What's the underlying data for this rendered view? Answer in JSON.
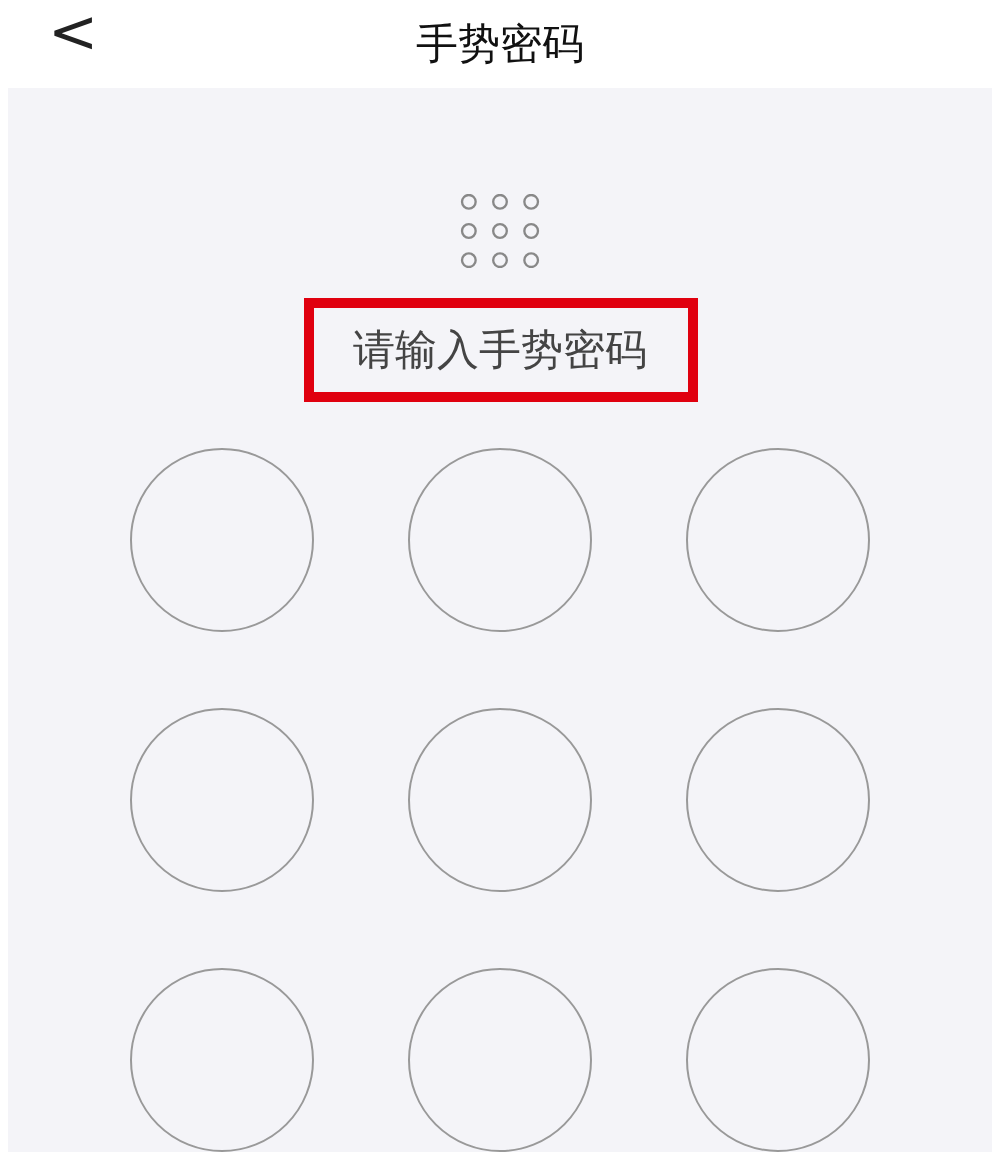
{
  "header": {
    "back": "<",
    "title": "手势密码"
  },
  "prompt": {
    "text": "请输入手势密码",
    "highlighted": true
  },
  "nodes": [
    {
      "selected": false
    },
    {
      "selected": false
    },
    {
      "selected": false
    },
    {
      "selected": false
    },
    {
      "selected": false
    },
    {
      "selected": false
    },
    {
      "selected": false
    },
    {
      "selected": false
    },
    {
      "selected": false
    }
  ]
}
